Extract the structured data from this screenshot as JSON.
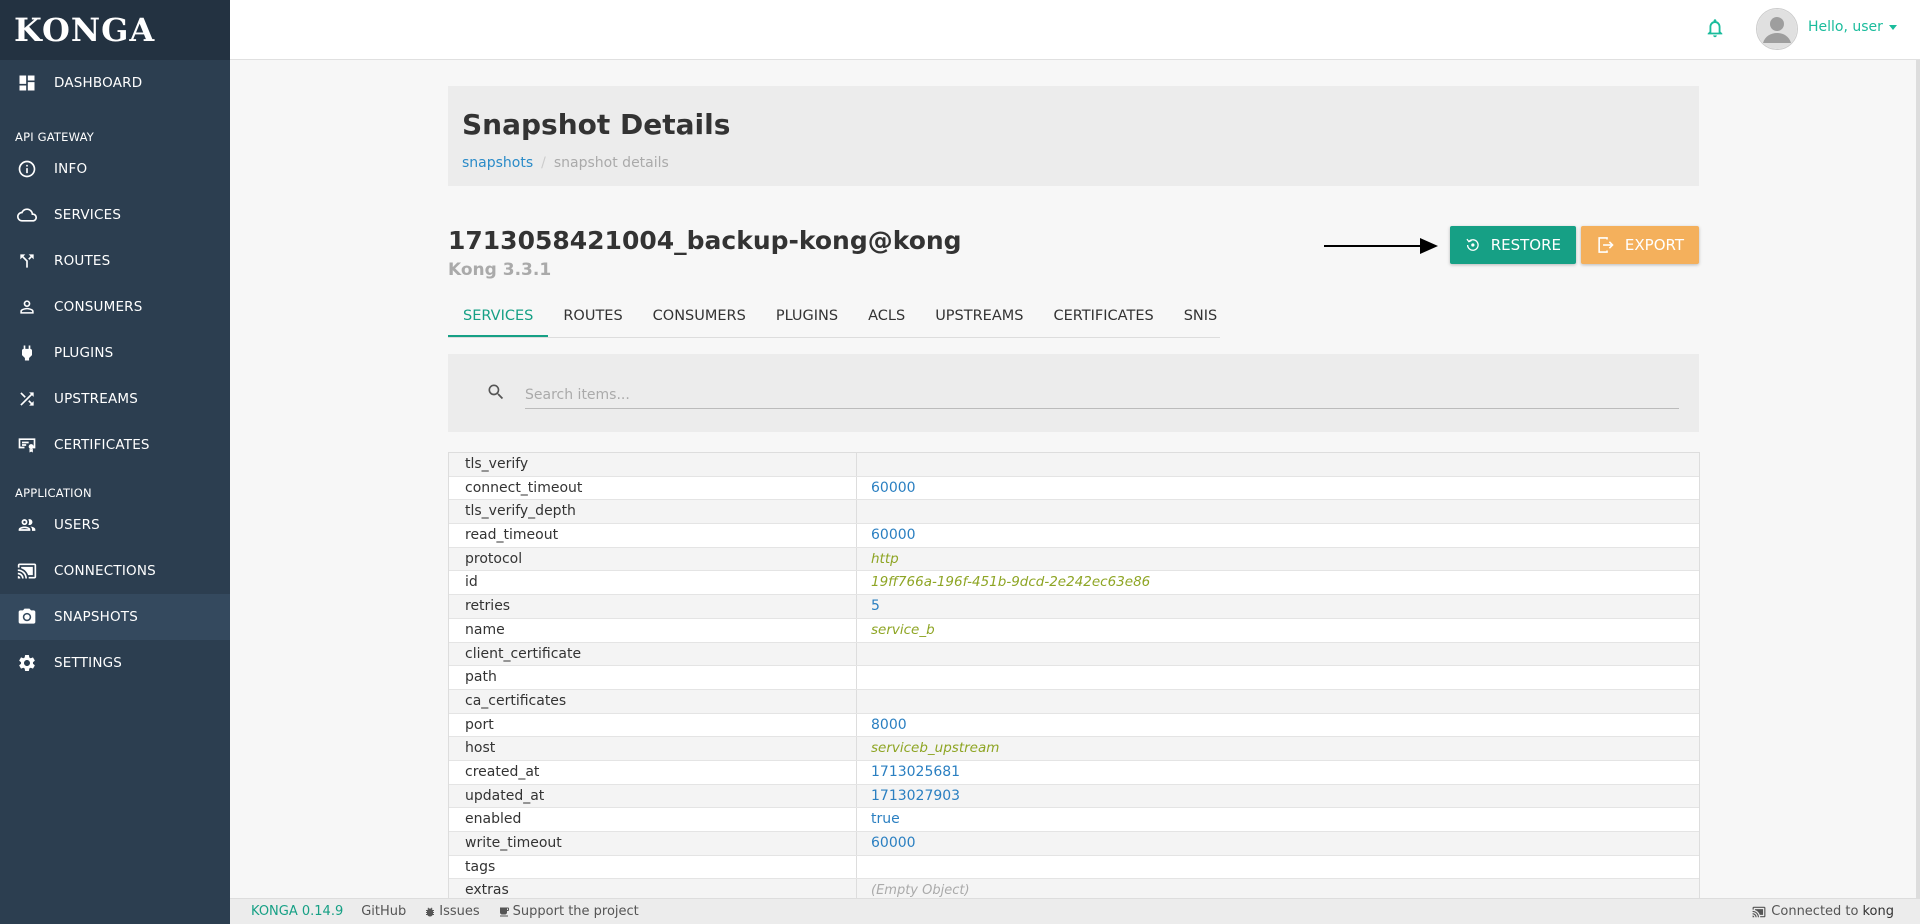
{
  "brand": "KONGA",
  "sidebar": {
    "dashboard": "DASHBOARD",
    "section_api": "API GATEWAY",
    "items_api": [
      {
        "label": "INFO",
        "icon": "info-icon"
      },
      {
        "label": "SERVICES",
        "icon": "cloud-icon"
      },
      {
        "label": "ROUTES",
        "icon": "routes-icon"
      },
      {
        "label": "CONSUMERS",
        "icon": "person-icon"
      },
      {
        "label": "PLUGINS",
        "icon": "plug-icon"
      },
      {
        "label": "UPSTREAMS",
        "icon": "shuffle-icon"
      },
      {
        "label": "CERTIFICATES",
        "icon": "certificate-icon"
      }
    ],
    "section_app": "APPLICATION",
    "items_app": [
      {
        "label": "USERS",
        "icon": "users-icon"
      },
      {
        "label": "CONNECTIONS",
        "icon": "cast-icon"
      },
      {
        "label": "SNAPSHOTS",
        "icon": "camera-icon",
        "active": true
      },
      {
        "label": "SETTINGS",
        "icon": "gear-icon"
      }
    ]
  },
  "topbar": {
    "greeting": "Hello, user"
  },
  "header": {
    "title": "Snapshot Details",
    "breadcrumb": [
      "snapshots",
      "snapshot details"
    ]
  },
  "snapshot": {
    "name": "1713058421004_backup-kong@kong",
    "version": "Kong 3.3.1",
    "restore_label": "RESTORE",
    "export_label": "EXPORT"
  },
  "tabs": [
    "SERVICES",
    "ROUTES",
    "CONSUMERS",
    "PLUGINS",
    "ACLS",
    "UPSTREAMS",
    "CERTIFICATES",
    "SNIS"
  ],
  "search": {
    "placeholder": "Search items..."
  },
  "table_rows": [
    {
      "key": "tls_verify",
      "value": "",
      "type": "empty"
    },
    {
      "key": "connect_timeout",
      "value": "60000",
      "type": "num"
    },
    {
      "key": "tls_verify_depth",
      "value": "",
      "type": "empty"
    },
    {
      "key": "read_timeout",
      "value": "60000",
      "type": "num"
    },
    {
      "key": "protocol",
      "value": "http",
      "type": "str"
    },
    {
      "key": "id",
      "value": "19ff766a-196f-451b-9dcd-2e242ec63e86",
      "type": "str"
    },
    {
      "key": "retries",
      "value": "5",
      "type": "num"
    },
    {
      "key": "name",
      "value": "service_b",
      "type": "str"
    },
    {
      "key": "client_certificate",
      "value": "",
      "type": "empty"
    },
    {
      "key": "path",
      "value": "",
      "type": "empty"
    },
    {
      "key": "ca_certificates",
      "value": "",
      "type": "empty"
    },
    {
      "key": "port",
      "value": "8000",
      "type": "num"
    },
    {
      "key": "host",
      "value": "serviceb_upstream",
      "type": "str"
    },
    {
      "key": "created_at",
      "value": "1713025681",
      "type": "num"
    },
    {
      "key": "updated_at",
      "value": "1713027903",
      "type": "num"
    },
    {
      "key": "enabled",
      "value": "true",
      "type": "bool"
    },
    {
      "key": "write_timeout",
      "value": "60000",
      "type": "num"
    },
    {
      "key": "tags",
      "value": "",
      "type": "empty"
    },
    {
      "key": "extras",
      "value": "(Empty Object)",
      "type": "obj"
    }
  ],
  "footer": {
    "version": "KONGA 0.14.9",
    "github": "GitHub",
    "issues": "Issues",
    "support": "Support the project",
    "connected_label": "Connected to",
    "connected_to": "kong"
  },
  "colors": {
    "sidebar": "#2c3e50",
    "accent": "#16a085",
    "restore": "#16a085",
    "export": "#f4b05c",
    "number": "#2a7fc1",
    "string": "#8ea524"
  }
}
